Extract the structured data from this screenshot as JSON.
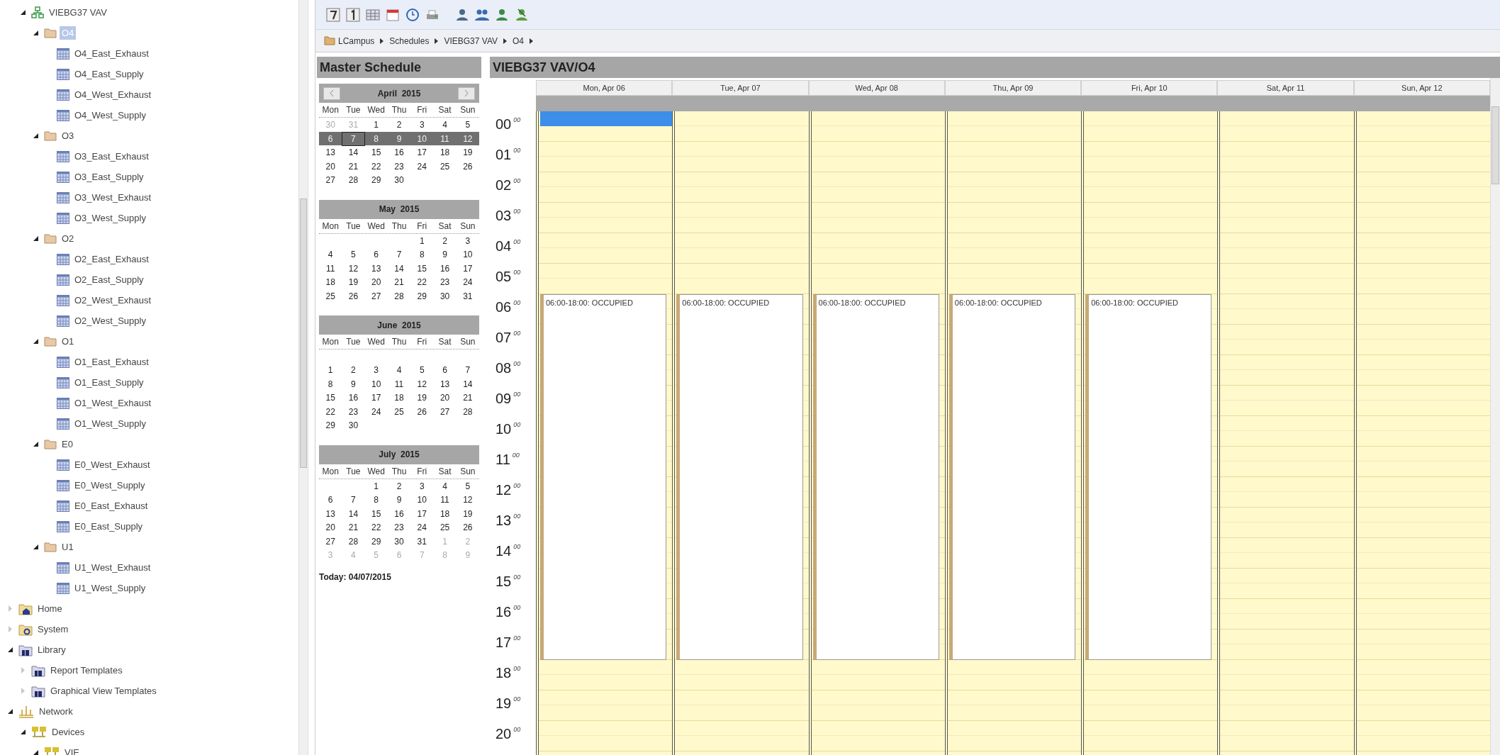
{
  "schedule_tree": [
    {
      "label": "VIEBG37 VAV",
      "kind": "device",
      "expanded": true,
      "selected": false,
      "children": [
        {
          "label": "O4",
          "kind": "folder",
          "expanded": true,
          "selected": true,
          "children": [
            {
              "label": "O4_East_Exhaust",
              "kind": "schedule",
              "selected": false
            },
            {
              "label": "O4_East_Supply",
              "kind": "schedule",
              "selected": false
            },
            {
              "label": "O4_West_Exhaust",
              "kind": "schedule",
              "selected": false
            },
            {
              "label": "O4_West_Supply",
              "kind": "schedule",
              "selected": false
            }
          ]
        },
        {
          "label": "O3",
          "kind": "folder",
          "expanded": true,
          "selected": false,
          "children": [
            {
              "label": "O3_East_Exhaust",
              "kind": "schedule",
              "selected": false
            },
            {
              "label": "O3_East_Supply",
              "kind": "schedule",
              "selected": false
            },
            {
              "label": "O3_West_Exhaust",
              "kind": "schedule",
              "selected": false
            },
            {
              "label": "O3_West_Supply",
              "kind": "schedule",
              "selected": false
            }
          ]
        },
        {
          "label": "O2",
          "kind": "folder",
          "expanded": true,
          "selected": false,
          "children": [
            {
              "label": "O2_East_Exhaust",
              "kind": "schedule",
              "selected": false
            },
            {
              "label": "O2_East_Supply",
              "kind": "schedule",
              "selected": false
            },
            {
              "label": "O2_West_Exhaust",
              "kind": "schedule",
              "selected": false
            },
            {
              "label": "O2_West_Supply",
              "kind": "schedule",
              "selected": false
            }
          ]
        },
        {
          "label": "O1",
          "kind": "folder",
          "expanded": true,
          "selected": false,
          "children": [
            {
              "label": "O1_East_Exhaust",
              "kind": "schedule",
              "selected": false
            },
            {
              "label": "O1_East_Supply",
              "kind": "schedule",
              "selected": false
            },
            {
              "label": "O1_West_Exhaust",
              "kind": "schedule",
              "selected": false
            },
            {
              "label": "O1_West_Supply",
              "kind": "schedule",
              "selected": false
            }
          ]
        },
        {
          "label": "E0",
          "kind": "folder",
          "expanded": true,
          "selected": false,
          "children": [
            {
              "label": "E0_West_Exhaust",
              "kind": "schedule",
              "selected": false
            },
            {
              "label": "E0_West_Supply",
              "kind": "schedule",
              "selected": false
            },
            {
              "label": "E0_East_Exhaust",
              "kind": "schedule",
              "selected": false
            },
            {
              "label": "E0_East_Supply",
              "kind": "schedule",
              "selected": false
            }
          ]
        },
        {
          "label": "U1",
          "kind": "folder",
          "expanded": true,
          "selected": false,
          "children": [
            {
              "label": "U1_West_Exhaust",
              "kind": "schedule",
              "selected": false
            },
            {
              "label": "U1_West_Supply",
              "kind": "schedule",
              "selected": false
            }
          ]
        }
      ]
    }
  ],
  "navigation_tree": [
    {
      "label": "Home",
      "kind": "home",
      "expanded": false,
      "selected": false
    },
    {
      "label": "System",
      "kind": "system",
      "expanded": false,
      "selected": false
    },
    {
      "label": "Library",
      "kind": "library",
      "expanded": true,
      "selected": false,
      "children": [
        {
          "label": "Report Templates",
          "kind": "library",
          "expanded": false,
          "selected": false
        },
        {
          "label": "Graphical View Templates",
          "kind": "library",
          "expanded": false,
          "selected": false
        }
      ]
    },
    {
      "label": "Network",
      "kind": "network",
      "expanded": true,
      "selected": false,
      "children": [
        {
          "label": "Devices",
          "kind": "devices",
          "expanded": true,
          "selected": false,
          "children": [
            {
              "label": "VIE",
              "kind": "devices",
              "expanded": true,
              "selected": false
            }
          ]
        }
      ]
    }
  ],
  "breadcrumb": [
    "LCampus",
    "Schedules",
    "VIEBG37 VAV",
    "O4"
  ],
  "master_schedule": {
    "title": "Master Schedule",
    "today": "Today: 04/07/2015",
    "months": [
      {
        "title": "April  2015",
        "kind": "navigable",
        "weekdays": [
          "Mon",
          "Tue",
          "Wed",
          "Thu",
          "Fri",
          "Sat",
          "Sun"
        ],
        "weeks": [
          {
            "kind": "full",
            "selected": false,
            "days": [
              {
                "label": "30",
                "muted": true,
                "today": false
              },
              {
                "label": "31",
                "muted": true,
                "today": false
              },
              {
                "label": "1",
                "muted": false,
                "today": false
              },
              {
                "label": "2",
                "muted": false,
                "today": false
              },
              {
                "label": "3",
                "muted": false,
                "today": false
              },
              {
                "label": "4",
                "muted": false,
                "today": false
              },
              {
                "label": "5",
                "muted": false,
                "today": false
              }
            ]
          },
          {
            "kind": "full",
            "selected": true,
            "days": [
              {
                "label": "6",
                "muted": false,
                "today": false
              },
              {
                "label": "7",
                "muted": false,
                "today": true
              },
              {
                "label": "8",
                "muted": false,
                "today": false
              },
              {
                "label": "9",
                "muted": false,
                "today": false
              },
              {
                "label": "10",
                "muted": false,
                "today": false
              },
              {
                "label": "11",
                "muted": false,
                "today": false
              },
              {
                "label": "12",
                "muted": false,
                "today": false
              }
            ]
          },
          {
            "kind": "full",
            "selected": false,
            "days": [
              {
                "label": "13",
                "muted": false,
                "today": false
              },
              {
                "label": "14",
                "muted": false,
                "today": false
              },
              {
                "label": "15",
                "muted": false,
                "today": false
              },
              {
                "label": "16",
                "muted": false,
                "today": false
              },
              {
                "label": "17",
                "muted": false,
                "today": false
              },
              {
                "label": "18",
                "muted": false,
                "today": false
              },
              {
                "label": "19",
                "muted": false,
                "today": false
              }
            ]
          },
          {
            "kind": "full",
            "selected": false,
            "days": [
              {
                "label": "20",
                "muted": false,
                "today": false
              },
              {
                "label": "21",
                "muted": false,
                "today": false
              },
              {
                "label": "22",
                "muted": false,
                "today": false
              },
              {
                "label": "23",
                "muted": false,
                "today": false
              },
              {
                "label": "24",
                "muted": false,
                "today": false
              },
              {
                "label": "25",
                "muted": false,
                "today": false
              },
              {
                "label": "26",
                "muted": false,
                "today": false
              }
            ]
          },
          {
            "kind": "start",
            "selected": false,
            "days": [
              {
                "label": "27",
                "muted": false,
                "today": false
              },
              {
                "label": "28",
                "muted": false,
                "today": false
              },
              {
                "label": "29",
                "muted": false,
                "today": false
              },
              {
                "label": "30",
                "muted": false,
                "today": false
              }
            ]
          }
        ]
      },
      {
        "title": "May  2015",
        "kind": "plain",
        "weekdays": [
          "Mon",
          "Tue",
          "Wed",
          "Thu",
          "Fri",
          "Sat",
          "Sun"
        ],
        "weeks": [
          {
            "kind": "end",
            "selected": false,
            "days": [
              {
                "label": "1",
                "muted": false,
                "today": false
              },
              {
                "label": "2",
                "muted": false,
                "today": false
              },
              {
                "label": "3",
                "muted": false,
                "today": false
              }
            ]
          },
          {
            "kind": "full",
            "selected": false,
            "days": [
              {
                "label": "4",
                "muted": false,
                "today": false
              },
              {
                "label": "5",
                "muted": false,
                "today": false
              },
              {
                "label": "6",
                "muted": false,
                "today": false
              },
              {
                "label": "7",
                "muted": false,
                "today": false
              },
              {
                "label": "8",
                "muted": false,
                "today": false
              },
              {
                "label": "9",
                "muted": false,
                "today": false
              },
              {
                "label": "10",
                "muted": false,
                "today": false
              }
            ]
          },
          {
            "kind": "full",
            "selected": false,
            "days": [
              {
                "label": "11",
                "muted": false,
                "today": false
              },
              {
                "label": "12",
                "muted": false,
                "today": false
              },
              {
                "label": "13",
                "muted": false,
                "today": false
              },
              {
                "label": "14",
                "muted": false,
                "today": false
              },
              {
                "label": "15",
                "muted": false,
                "today": false
              },
              {
                "label": "16",
                "muted": false,
                "today": false
              },
              {
                "label": "17",
                "muted": false,
                "today": false
              }
            ]
          },
          {
            "kind": "full",
            "selected": false,
            "days": [
              {
                "label": "18",
                "muted": false,
                "today": false
              },
              {
                "label": "19",
                "muted": false,
                "today": false
              },
              {
                "label": "20",
                "muted": false,
                "today": false
              },
              {
                "label": "21",
                "muted": false,
                "today": false
              },
              {
                "label": "22",
                "muted": false,
                "today": false
              },
              {
                "label": "23",
                "muted": false,
                "today": false
              },
              {
                "label": "24",
                "muted": false,
                "today": false
              }
            ]
          },
          {
            "kind": "full",
            "selected": false,
            "days": [
              {
                "label": "25",
                "muted": false,
                "today": false
              },
              {
                "label": "26",
                "muted": false,
                "today": false
              },
              {
                "label": "27",
                "muted": false,
                "today": false
              },
              {
                "label": "28",
                "muted": false,
                "today": false
              },
              {
                "label": "29",
                "muted": false,
                "today": false
              },
              {
                "label": "30",
                "muted": false,
                "today": false
              },
              {
                "label": "31",
                "muted": false,
                "today": false
              }
            ]
          }
        ]
      },
      {
        "title": "June  2015",
        "kind": "gapped",
        "weekdays": [
          "Mon",
          "Tue",
          "Wed",
          "Thu",
          "Fri",
          "Sat",
          "Sun"
        ],
        "weeks": [
          {
            "kind": "full",
            "selected": false,
            "days": [
              {
                "label": "1",
                "muted": false,
                "today": false
              },
              {
                "label": "2",
                "muted": false,
                "today": false
              },
              {
                "label": "3",
                "muted": false,
                "today": false
              },
              {
                "label": "4",
                "muted": false,
                "today": false
              },
              {
                "label": "5",
                "muted": false,
                "today": false
              },
              {
                "label": "6",
                "muted": false,
                "today": false
              },
              {
                "label": "7",
                "muted": false,
                "today": false
              }
            ]
          },
          {
            "kind": "full",
            "selected": false,
            "days": [
              {
                "label": "8",
                "muted": false,
                "today": false
              },
              {
                "label": "9",
                "muted": false,
                "today": false
              },
              {
                "label": "10",
                "muted": false,
                "today": false
              },
              {
                "label": "11",
                "muted": false,
                "today": false
              },
              {
                "label": "12",
                "muted": false,
                "today": false
              },
              {
                "label": "13",
                "muted": false,
                "today": false
              },
              {
                "label": "14",
                "muted": false,
                "today": false
              }
            ]
          },
          {
            "kind": "full",
            "selected": false,
            "days": [
              {
                "label": "15",
                "muted": false,
                "today": false
              },
              {
                "label": "16",
                "muted": false,
                "today": false
              },
              {
                "label": "17",
                "muted": false,
                "today": false
              },
              {
                "label": "18",
                "muted": false,
                "today": false
              },
              {
                "label": "19",
                "muted": false,
                "today": false
              },
              {
                "label": "20",
                "muted": false,
                "today": false
              },
              {
                "label": "21",
                "muted": false,
                "today": false
              }
            ]
          },
          {
            "kind": "full",
            "selected": false,
            "days": [
              {
                "label": "22",
                "muted": false,
                "today": false
              },
              {
                "label": "23",
                "muted": false,
                "today": false
              },
              {
                "label": "24",
                "muted": false,
                "today": false
              },
              {
                "label": "25",
                "muted": false,
                "today": false
              },
              {
                "label": "26",
                "muted": false,
                "today": false
              },
              {
                "label": "27",
                "muted": false,
                "today": false
              },
              {
                "label": "28",
                "muted": false,
                "today": false
              }
            ]
          },
          {
            "kind": "start",
            "selected": false,
            "days": [
              {
                "label": "29",
                "muted": false,
                "today": false
              },
              {
                "label": "30",
                "muted": false,
                "today": false
              }
            ]
          }
        ]
      },
      {
        "title": "July  2015",
        "kind": "plain",
        "weekdays": [
          "Mon",
          "Tue",
          "Wed",
          "Thu",
          "Fri",
          "Sat",
          "Sun"
        ],
        "weeks": [
          {
            "kind": "end",
            "selected": false,
            "days": [
              {
                "label": "1",
                "muted": false,
                "today": false
              },
              {
                "label": "2",
                "muted": false,
                "today": false
              },
              {
                "label": "3",
                "muted": false,
                "today": false
              },
              {
                "label": "4",
                "muted": false,
                "today": false
              },
              {
                "label": "5",
                "muted": false,
                "today": false
              }
            ]
          },
          {
            "kind": "full",
            "selected": false,
            "days": [
              {
                "label": "6",
                "muted": false,
                "today": false
              },
              {
                "label": "7",
                "muted": false,
                "today": false
              },
              {
                "label": "8",
                "muted": false,
                "today": false
              },
              {
                "label": "9",
                "muted": false,
                "today": false
              },
              {
                "label": "10",
                "muted": false,
                "today": false
              },
              {
                "label": "11",
                "muted": false,
                "today": false
              },
              {
                "label": "12",
                "muted": false,
                "today": false
              }
            ]
          },
          {
            "kind": "full",
            "selected": false,
            "days": [
              {
                "label": "13",
                "muted": false,
                "today": false
              },
              {
                "label": "14",
                "muted": false,
                "today": false
              },
              {
                "label": "15",
                "muted": false,
                "today": false
              },
              {
                "label": "16",
                "muted": false,
                "today": false
              },
              {
                "label": "17",
                "muted": false,
                "today": false
              },
              {
                "label": "18",
                "muted": false,
                "today": false
              },
              {
                "label": "19",
                "muted": false,
                "today": false
              }
            ]
          },
          {
            "kind": "full",
            "selected": false,
            "days": [
              {
                "label": "20",
                "muted": false,
                "today": false
              },
              {
                "label": "21",
                "muted": false,
                "today": false
              },
              {
                "label": "22",
                "muted": false,
                "today": false
              },
              {
                "label": "23",
                "muted": false,
                "today": false
              },
              {
                "label": "24",
                "muted": false,
                "today": false
              },
              {
                "label": "25",
                "muted": false,
                "today": false
              },
              {
                "label": "26",
                "muted": false,
                "today": false
              }
            ]
          },
          {
            "kind": "full",
            "selected": false,
            "days": [
              {
                "label": "27",
                "muted": false,
                "today": false
              },
              {
                "label": "28",
                "muted": false,
                "today": false
              },
              {
                "label": "29",
                "muted": false,
                "today": false
              },
              {
                "label": "30",
                "muted": false,
                "today": false
              },
              {
                "label": "31",
                "muted": false,
                "today": false
              },
              {
                "label": "1",
                "muted": true,
                "today": false
              },
              {
                "label": "2",
                "muted": true,
                "today": false
              }
            ]
          },
          {
            "kind": "full",
            "selected": false,
            "days": [
              {
                "label": "3",
                "muted": true,
                "today": false
              },
              {
                "label": "4",
                "muted": true,
                "today": false
              },
              {
                "label": "5",
                "muted": true,
                "today": false
              },
              {
                "label": "6",
                "muted": true,
                "today": false
              },
              {
                "label": "7",
                "muted": true,
                "today": false
              },
              {
                "label": "8",
                "muted": true,
                "today": false
              },
              {
                "label": "9",
                "muted": true,
                "today": false
              }
            ]
          }
        ]
      }
    ]
  },
  "day_view": {
    "title": "VIEBG37 VAV/O4",
    "hours": [
      {
        "hour": "00",
        "minutes": "00"
      },
      {
        "hour": "01",
        "minutes": "00"
      },
      {
        "hour": "02",
        "minutes": "00"
      },
      {
        "hour": "03",
        "minutes": "00"
      },
      {
        "hour": "04",
        "minutes": "00"
      },
      {
        "hour": "05",
        "minutes": "00"
      },
      {
        "hour": "06",
        "minutes": "00"
      },
      {
        "hour": "07",
        "minutes": "00"
      },
      {
        "hour": "08",
        "minutes": "00"
      },
      {
        "hour": "09",
        "minutes": "00"
      },
      {
        "hour": "10",
        "minutes": "00"
      },
      {
        "hour": "11",
        "minutes": "00"
      },
      {
        "hour": "12",
        "minutes": "00"
      },
      {
        "hour": "13",
        "minutes": "00"
      },
      {
        "hour": "14",
        "minutes": "00"
      },
      {
        "hour": "15",
        "minutes": "00"
      },
      {
        "hour": "16",
        "minutes": "00"
      },
      {
        "hour": "17",
        "minutes": "00"
      },
      {
        "hour": "18",
        "minutes": "00"
      },
      {
        "hour": "19",
        "minutes": "00"
      },
      {
        "hour": "20",
        "minutes": "00"
      }
    ],
    "days": [
      {
        "label": "Mon, Apr 06",
        "selected": true,
        "events": [
          "06:00-18:00: OCCUPIED"
        ]
      },
      {
        "label": "Tue, Apr 07",
        "selected": false,
        "events": [
          "06:00-18:00: OCCUPIED"
        ]
      },
      {
        "label": "Wed, Apr 08",
        "selected": false,
        "events": [
          "06:00-18:00: OCCUPIED"
        ]
      },
      {
        "label": "Thu, Apr 09",
        "selected": false,
        "events": [
          "06:00-18:00: OCCUPIED"
        ]
      },
      {
        "label": "Fri, Apr 10",
        "selected": false,
        "events": [
          "06:00-18:00: OCCUPIED"
        ]
      },
      {
        "label": "Sat, Apr 11",
        "selected": false
      },
      {
        "label": "Sun, Apr 12",
        "selected": false
      }
    ]
  }
}
